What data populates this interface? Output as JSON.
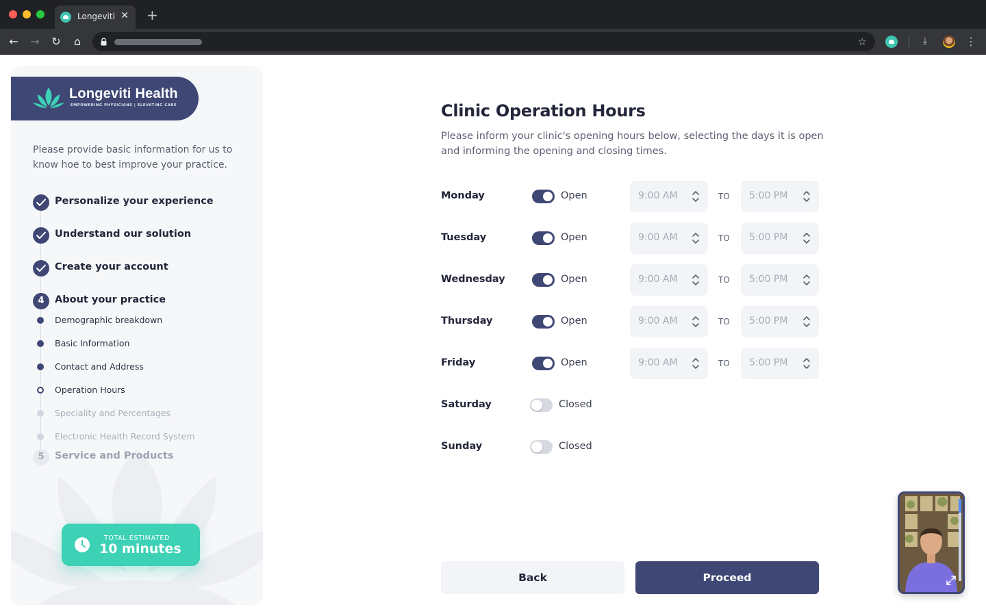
{
  "browser": {
    "tab_title": "Longeviti",
    "tab_close": "✕",
    "new_tab": "+",
    "nav": {
      "back": "←",
      "forward": "→",
      "reload": "↻",
      "home": "⌂"
    },
    "icons": {
      "star": "☆",
      "download": "⤓",
      "menu": "⋮"
    }
  },
  "sidebar": {
    "brand": {
      "name": "Longeviti Health",
      "tagline": "EMPOWERING PHYSICIANS | ELEVATING CARE"
    },
    "intro": "Please provide basic information for us to know hoe to best improve your practice.",
    "steps": [
      {
        "label": "Personalize your experience",
        "status": "complete"
      },
      {
        "label": "Understand our solution",
        "status": "complete"
      },
      {
        "label": "Create your account",
        "status": "complete"
      },
      {
        "number": "4",
        "label": "About your practice",
        "status": "active"
      },
      {
        "number": "5",
        "label": "Service and Products",
        "status": "pending"
      }
    ],
    "substeps": [
      {
        "label": "Demographic breakdown",
        "status": "complete"
      },
      {
        "label": "Basic Information",
        "status": "complete"
      },
      {
        "label": "Contact and Address",
        "status": "complete"
      },
      {
        "label": "Operation Hours",
        "status": "current"
      },
      {
        "label": "Speciality and Percentages",
        "status": "pending"
      },
      {
        "label": "Electronic Health Record System",
        "status": "pending"
      }
    ],
    "estimate": {
      "caption": "TOTAL ESTIMATED",
      "value": "10 minutes"
    }
  },
  "main": {
    "title": "Clinic Operation Hours",
    "description": "Please inform your clinic's opening hours below, selecting the days it is open and informing the opening and closing times.",
    "to_label": "TO",
    "days": [
      {
        "name": "Monday",
        "open": true,
        "status": "Open",
        "open_time": "9:00 AM",
        "close_time": "5:00 PM"
      },
      {
        "name": "Tuesday",
        "open": true,
        "status": "Open",
        "open_time": "9:00 AM",
        "close_time": "5:00 PM"
      },
      {
        "name": "Wednesday",
        "open": true,
        "status": "Open",
        "open_time": "9:00 AM",
        "close_time": "5:00 PM"
      },
      {
        "name": "Thursday",
        "open": true,
        "status": "Open",
        "open_time": "9:00 AM",
        "close_time": "5:00 PM"
      },
      {
        "name": "Friday",
        "open": true,
        "status": "Open",
        "open_time": "9:00 AM",
        "close_time": "5:00 PM"
      },
      {
        "name": "Saturday",
        "open": false,
        "status": "Closed"
      },
      {
        "name": "Sunday",
        "open": false,
        "status": "Closed"
      }
    ],
    "buttons": {
      "back": "Back",
      "proceed": "Proceed"
    }
  },
  "colors": {
    "primary": "#3f4775",
    "accent": "#3dd1b5",
    "input_bg": "#f3f4f7",
    "sidebar_bg": "#f6f7f9"
  }
}
